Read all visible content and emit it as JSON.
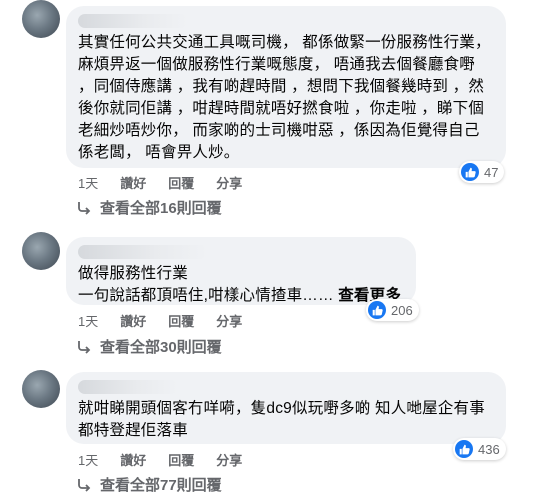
{
  "comments": [
    {
      "text": "其實任何公共交通工具嘅司機， 都係做緊一份服務性行業， 麻煩畀返一個做服務性行業嘅態度， 唔通我去個餐廳食嘢 ，同個侍應講 ，我有啲趕時間 ，想問下我個餐幾時到 ，然後你就同佢講 ，咁趕時間就唔好撚食啦 ，你走啦 ，睇下個老細炒唔炒你， 而家啲的士司機咁惡 ，係因為佢覺得自己係老闆， 唔會畀人炒。",
      "see_more": "",
      "reaction_count": "47",
      "time": "1天",
      "like_label": "讚好",
      "reply_label": "回覆",
      "share_label": "分享",
      "view_replies": "查看全部16則回覆"
    },
    {
      "text": "做得服務性行業\n一句說話都頂唔住,咁樣心情揸車……",
      "see_more": "查看更多",
      "reaction_count": "206",
      "time": "1天",
      "like_label": "讚好",
      "reply_label": "回覆",
      "share_label": "分享",
      "view_replies": "查看全部30則回覆"
    },
    {
      "text": "就咁睇開頭個客冇咩嗬，隻dc9似玩嘢多啲 知人哋屋企有事都特登趕佢落車",
      "see_more": "",
      "reaction_count": "436",
      "time": "1天",
      "like_label": "讚好",
      "reply_label": "回覆",
      "share_label": "分享",
      "view_replies": "查看全部77則回覆"
    }
  ],
  "colors": {
    "bubble": "#f0f2f5",
    "like_blue": "#1877f2",
    "meta_gray": "#65676b"
  },
  "icons": {
    "reaction": "like-thumb-icon",
    "reply": "reply-arrow-icon"
  }
}
